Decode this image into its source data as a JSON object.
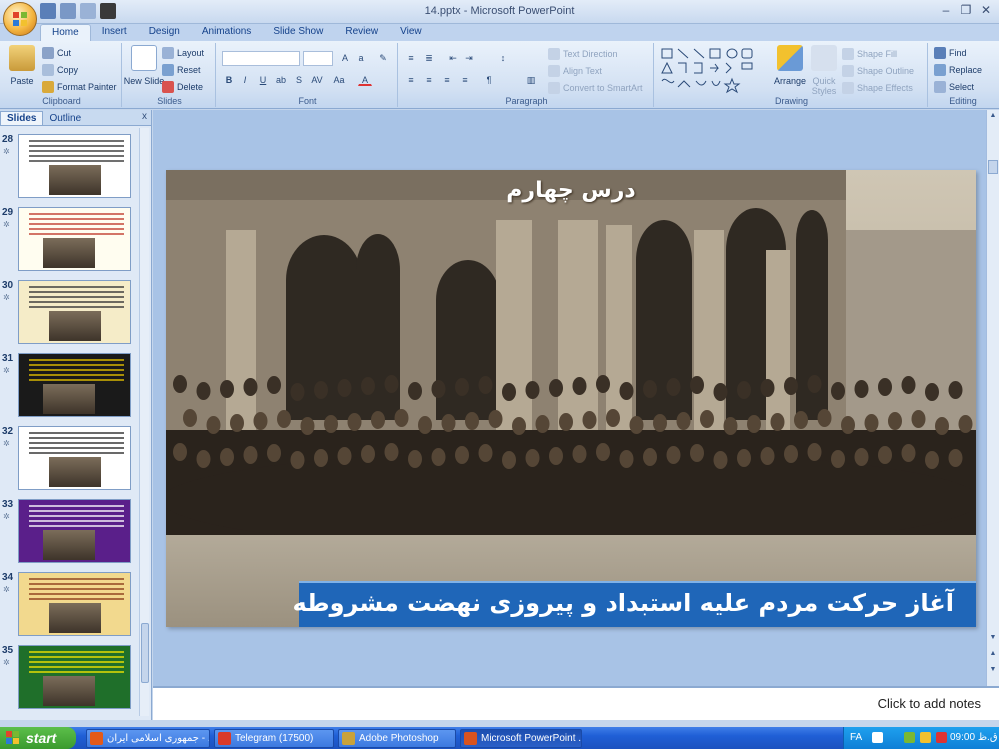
{
  "window": {
    "title": "14.pptx - Microsoft PowerPoint",
    "controls": {
      "minimize": "–",
      "restore": "❐",
      "close": "✕"
    }
  },
  "ribbon": {
    "tabs": [
      "Home",
      "Insert",
      "Design",
      "Animations",
      "Slide Show",
      "Review",
      "View"
    ],
    "active_tab": "Home",
    "clipboard": {
      "label": "Clipboard",
      "paste": "Paste",
      "cut": "Cut",
      "copy": "Copy",
      "format_painter": "Format Painter"
    },
    "slides": {
      "label": "Slides",
      "new_slide": "New Slide",
      "layout": "Layout",
      "reset": "Reset",
      "delete": "Delete"
    },
    "font": {
      "label": "Font"
    },
    "paragraph": {
      "label": "Paragraph",
      "text_direction": "Text Direction",
      "align_text": "Align Text",
      "convert_smartart": "Convert to SmartArt"
    },
    "drawing": {
      "label": "Drawing",
      "arrange": "Arrange",
      "quick_styles": "Quick Styles",
      "shape_fill": "Shape Fill",
      "shape_outline": "Shape Outline",
      "shape_effects": "Shape Effects"
    },
    "editing": {
      "label": "Editing",
      "find": "Find",
      "replace": "Replace",
      "select": "Select"
    }
  },
  "panel": {
    "tabs": [
      "Slides",
      "Outline"
    ],
    "active_tab": "Slides",
    "close": "x",
    "thumbnails": [
      {
        "number": "28",
        "bg": "#ffffff",
        "line": "#333333"
      },
      {
        "number": "29",
        "bg": "#fffdf0",
        "line": "#c0392b"
      },
      {
        "number": "30",
        "bg": "#f5ecc8",
        "line": "#333333"
      },
      {
        "number": "31",
        "bg": "#1a1a1a",
        "line": "#e5c200"
      },
      {
        "number": "32",
        "bg": "#ffffff",
        "line": "#2a2a2a"
      },
      {
        "number": "33",
        "bg": "#5a1f8a",
        "line": "#ffffff"
      },
      {
        "number": "34",
        "bg": "#f2d98e",
        "line": "#8a3a1a"
      },
      {
        "number": "35",
        "bg": "#1f6f2a",
        "line": "#f2e500"
      }
    ]
  },
  "slide": {
    "heading": "درس چهارم",
    "banner": "آغاز حرکت مردم علیه استبداد و پیروزی نهضت مشروطه",
    "banner_color": "#1f66b8"
  },
  "notes": {
    "placeholder": "Click to add notes"
  },
  "taskbar": {
    "start": "start",
    "items": [
      {
        "label": "جمهوری اسلامی ایران - ...",
        "color": "#e35a1a",
        "active": false
      },
      {
        "label": "Telegram (17500)",
        "color": "#d93a2a",
        "active": false
      },
      {
        "label": "Adobe Photoshop",
        "color": "#c9a23a",
        "active": false
      },
      {
        "label": "Microsoft PowerPoint ...",
        "color": "#d9531e",
        "active": true
      }
    ],
    "tray": {
      "lang": "FA",
      "time": "09:00 ق.ظ"
    }
  }
}
